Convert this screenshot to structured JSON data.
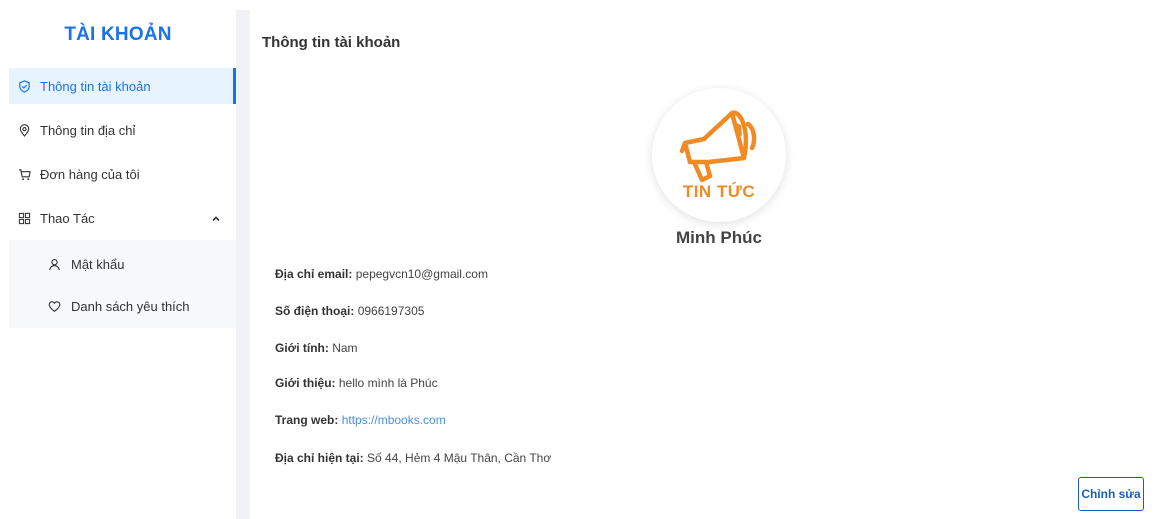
{
  "sidebar": {
    "title": "TÀI KHOẢN",
    "items": [
      {
        "label": "Thông tin tài khoản",
        "icon": "shield-check-icon",
        "active": true
      },
      {
        "label": "Thông tin địa chỉ",
        "icon": "location-pin-icon",
        "active": false
      },
      {
        "label": "Đơn hàng của tôi",
        "icon": "cart-icon",
        "active": false
      },
      {
        "label": "Thao Tác",
        "icon": "grid-icon",
        "active": false,
        "expanded": true
      }
    ],
    "subitems": [
      {
        "label": "Mật khẩu",
        "icon": "user-icon"
      },
      {
        "label": "Danh sách yêu thích",
        "icon": "heart-icon"
      }
    ]
  },
  "main": {
    "title": "Thông tin tài khoản",
    "avatar_text": "TIN TỨC",
    "user_name": "Minh Phúc",
    "fields": [
      {
        "label": "Địa chỉ email:",
        "value": "pepegvcn10@gmail.com"
      },
      {
        "label": "Số điện thoại:",
        "value": "0966197305"
      },
      {
        "label": "Giới tính:",
        "value": "Nam"
      },
      {
        "label": "Giới thiệu:",
        "value": "hello mình là Phúc"
      },
      {
        "label": "Trang web:",
        "value": "https://mbooks.com"
      },
      {
        "label": "Địa chỉ hiện tại:",
        "value": "Số 44, Hẻm 4 Mậu Thân, Cần Thơ"
      }
    ],
    "edit_label": "Chỉnh sửa"
  },
  "colors": {
    "accent": "#1a73e8",
    "active_bg": "#e6f4ff",
    "link": "#4a90e2",
    "logo_orange": "#f08a24",
    "button_border": "#1a5fb4"
  }
}
